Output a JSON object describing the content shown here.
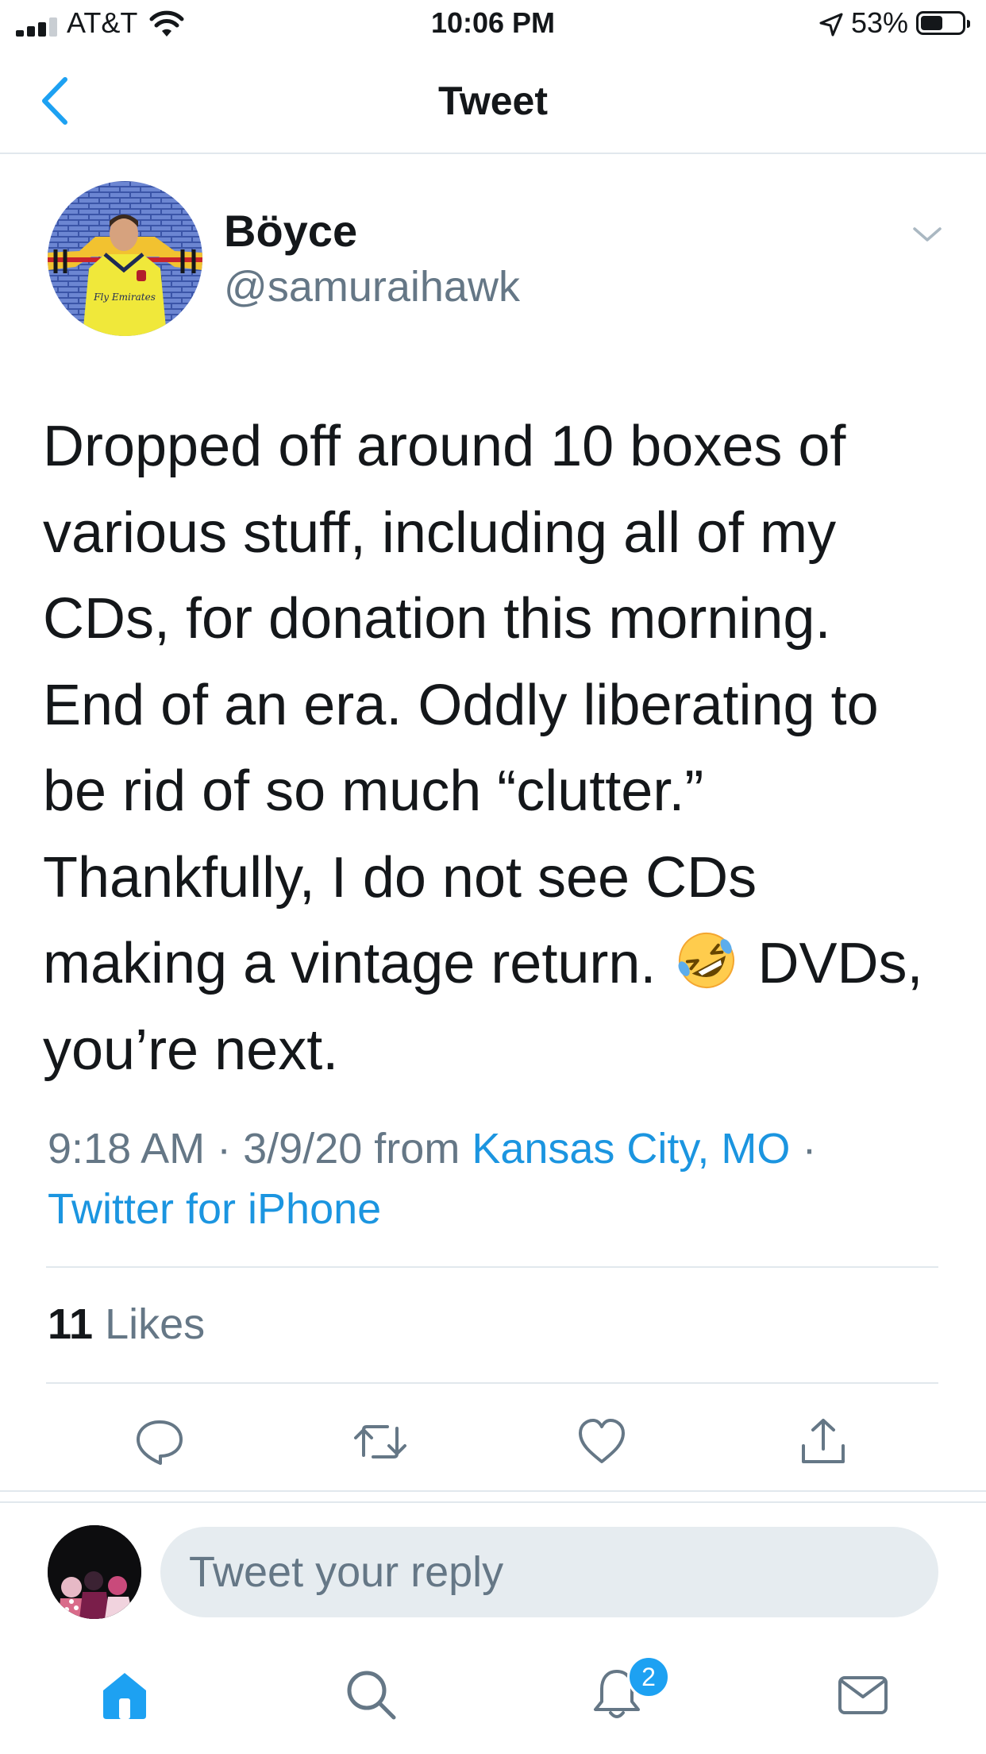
{
  "status_bar": {
    "carrier": "AT&T",
    "time": "10:06 PM",
    "battery": "53%",
    "battery_level": 0.53,
    "signal_bars": 3
  },
  "nav": {
    "title": "Tweet",
    "back_icon": "chevron-left-icon"
  },
  "tweet": {
    "author": {
      "display_name": "Böyce",
      "handle": "@samuraihawk",
      "avatar_shirt_text": "Fly Emirates"
    },
    "text_lines": [
      "Dropped off around 10 boxes of",
      "various stuff, including all of my",
      "CDs, for donation this morning.",
      "End of an era. Oddly liberating to",
      "be rid of so much “clutter.”",
      "Thankfully, I do not see CDs",
      "making a vintage return.",
      "DVDs,",
      "you’re next."
    ],
    "emoji": "rolling-on-floor-laughing-emoji",
    "meta": {
      "time": "9:18 AM",
      "separator": "·",
      "date": "3/9/20",
      "from": "from",
      "location": "Kansas City, MO",
      "separator2": "·",
      "source": "Twitter for iPhone"
    },
    "likes_count": "11",
    "likes_label": "Likes"
  },
  "actions": [
    "reply-icon",
    "retweet-icon",
    "like-icon",
    "share-icon"
  ],
  "reply": {
    "placeholder": "Tweet your reply"
  },
  "tab_bar": {
    "tabs": [
      "home-icon",
      "search-icon",
      "notifications-icon",
      "messages-icon"
    ],
    "notifications_badge": "2"
  },
  "colors": {
    "accent": "#1b95e0",
    "text": "#14171a",
    "secondary_text": "#657786",
    "divider": "#e1e8ed",
    "reply_bg": "#e6ecf0"
  }
}
